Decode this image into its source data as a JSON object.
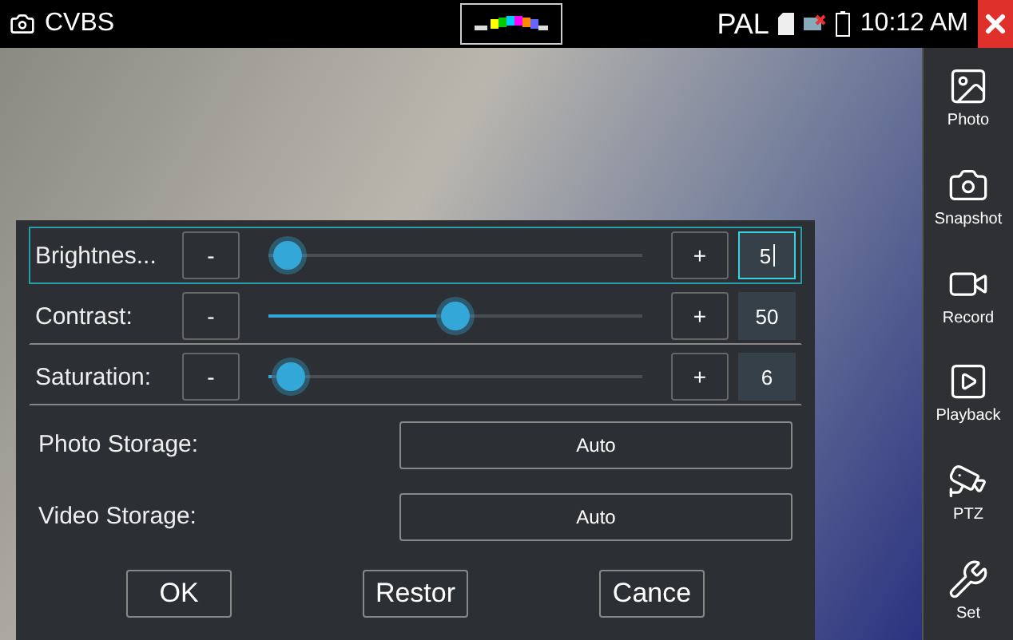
{
  "status_bar": {
    "source": "CVBS",
    "standard": "PAL",
    "time": "10:12 AM"
  },
  "sidebar": {
    "items": [
      {
        "label": "Photo"
      },
      {
        "label": "Snapshot"
      },
      {
        "label": "Record"
      },
      {
        "label": "Playback"
      },
      {
        "label": "PTZ"
      },
      {
        "label": "Set"
      }
    ]
  },
  "dialog": {
    "sliders": [
      {
        "label": "Brightnes...",
        "minus": "-",
        "plus": "+",
        "level": 0.05,
        "value": "5",
        "selected": true
      },
      {
        "label": "Contrast:",
        "minus": "-",
        "plus": "+",
        "level": 0.5,
        "value": "50",
        "selected": false
      },
      {
        "label": "Saturation:",
        "minus": "-",
        "plus": "+",
        "level": 0.06,
        "value": "6",
        "selected": false
      }
    ],
    "storage": [
      {
        "label": "Photo Storage:",
        "value": "Auto"
      },
      {
        "label": "Video Storage:",
        "value": "Auto"
      }
    ],
    "buttons": [
      "OK",
      "Restor",
      "Cance"
    ]
  }
}
